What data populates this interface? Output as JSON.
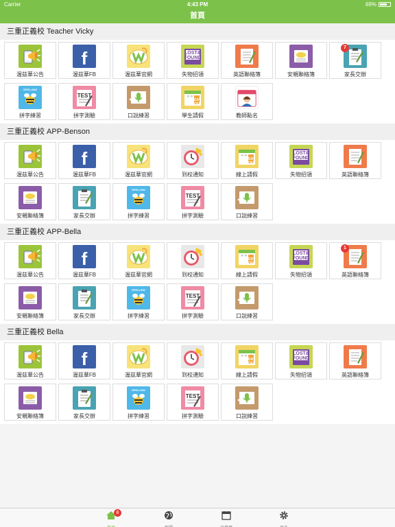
{
  "status": {
    "carrier": "Carrier",
    "time": "4:43 PM",
    "battery": "69%",
    "battery_level": 0.69
  },
  "nav": {
    "title": "首頁"
  },
  "sections": [
    {
      "title": "三重正義校 Teacher Vicky",
      "items": [
        {
          "label": "渥茲華公告",
          "icon": "megaphone-icon"
        },
        {
          "label": "渥茲華FB",
          "icon": "facebook-icon"
        },
        {
          "label": "渥茲華官網",
          "icon": "wordsworth-logo-icon"
        },
        {
          "label": "失物招領",
          "icon": "lost-found-icon"
        },
        {
          "label": "英語聯絡簿",
          "icon": "english-notebook-icon"
        },
        {
          "label": "安親聯絡簿",
          "icon": "chat-notebook-icon"
        },
        {
          "label": "家長交辦",
          "icon": "clipboard-icon",
          "badge": "7"
        },
        {
          "label": "拼字練習",
          "icon": "spelling-bee-icon"
        },
        {
          "label": "拼字測驗",
          "icon": "test-paper-icon"
        },
        {
          "label": "口說練習",
          "icon": "speaking-mic-icon"
        },
        {
          "label": "學生請假",
          "icon": "day-off-calendar-icon"
        },
        {
          "label": "教師點名",
          "icon": "teacher-rollcall-icon"
        }
      ]
    },
    {
      "title": "三重正義校 APP-Benson",
      "items": [
        {
          "label": "渥茲華公告",
          "icon": "megaphone-icon"
        },
        {
          "label": "渥茲華FB",
          "icon": "facebook-icon"
        },
        {
          "label": "渥茲華官網",
          "icon": "wordsworth-logo-icon"
        },
        {
          "label": "到校通知",
          "icon": "arrival-clock-icon"
        },
        {
          "label": "線上請假",
          "icon": "day-off-calendar-icon"
        },
        {
          "label": "失物招領",
          "icon": "lost-found-icon"
        },
        {
          "label": "英語聯絡簿",
          "icon": "english-notebook-icon"
        },
        {
          "label": "安親聯絡簿",
          "icon": "chat-notebook-icon"
        },
        {
          "label": "家長交辦",
          "icon": "clipboard-icon"
        },
        {
          "label": "拼字練習",
          "icon": "spelling-bee-icon"
        },
        {
          "label": "拼字測驗",
          "icon": "test-paper-icon"
        },
        {
          "label": "口說練習",
          "icon": "speaking-mic-icon"
        }
      ]
    },
    {
      "title": "三重正義校 APP-Bella",
      "items": [
        {
          "label": "渥茲華公告",
          "icon": "megaphone-icon"
        },
        {
          "label": "渥茲華FB",
          "icon": "facebook-icon"
        },
        {
          "label": "渥茲華官網",
          "icon": "wordsworth-logo-icon"
        },
        {
          "label": "到校通知",
          "icon": "arrival-clock-icon"
        },
        {
          "label": "線上請假",
          "icon": "day-off-calendar-icon"
        },
        {
          "label": "失物招領",
          "icon": "lost-found-icon"
        },
        {
          "label": "英語聯絡簿",
          "icon": "english-notebook-icon",
          "badge": "1"
        },
        {
          "label": "安親聯絡簿",
          "icon": "chat-notebook-icon"
        },
        {
          "label": "家長交辦",
          "icon": "clipboard-icon"
        },
        {
          "label": "拼字練習",
          "icon": "spelling-bee-icon"
        },
        {
          "label": "拼字測驗",
          "icon": "test-paper-icon"
        },
        {
          "label": "口說練習",
          "icon": "speaking-mic-icon"
        }
      ]
    },
    {
      "title": "三重正義校 Bella",
      "items": [
        {
          "label": "渥茲華公告",
          "icon": "megaphone-icon"
        },
        {
          "label": "渥茲華FB",
          "icon": "facebook-icon"
        },
        {
          "label": "渥茲華官網",
          "icon": "wordsworth-logo-icon"
        },
        {
          "label": "到校通知",
          "icon": "arrival-clock-icon"
        },
        {
          "label": "線上請假",
          "icon": "day-off-calendar-icon"
        },
        {
          "label": "失物招領",
          "icon": "lost-found-icon"
        },
        {
          "label": "英語聯絡簿",
          "icon": "english-notebook-icon"
        },
        {
          "label": "安親聯絡簿",
          "icon": "chat-notebook-icon"
        },
        {
          "label": "家長交辦",
          "icon": "clipboard-icon"
        },
        {
          "label": "拼字練習",
          "icon": "spelling-bee-icon"
        },
        {
          "label": "拼字測驗",
          "icon": "test-paper-icon"
        },
        {
          "label": "口說練習",
          "icon": "speaking-mic-icon"
        }
      ]
    }
  ],
  "tabs": [
    {
      "label": "首頁",
      "icon": "home-icon",
      "badge": "8",
      "active": true
    },
    {
      "label": "新聞",
      "icon": "globe-icon"
    },
    {
      "label": "行事曆",
      "icon": "calendar-icon"
    },
    {
      "label": "更多",
      "icon": "gear-icon"
    }
  ],
  "icon_text": {
    "lost_found_1": "LOST&",
    "lost_found_2": "FOUND",
    "test": "TEST",
    "day": "DAY",
    "off": "OFF",
    "fb": "f",
    "bee": "SPELLING"
  },
  "colors": {
    "brand": "#7cc24a",
    "badge": "#e53935"
  }
}
